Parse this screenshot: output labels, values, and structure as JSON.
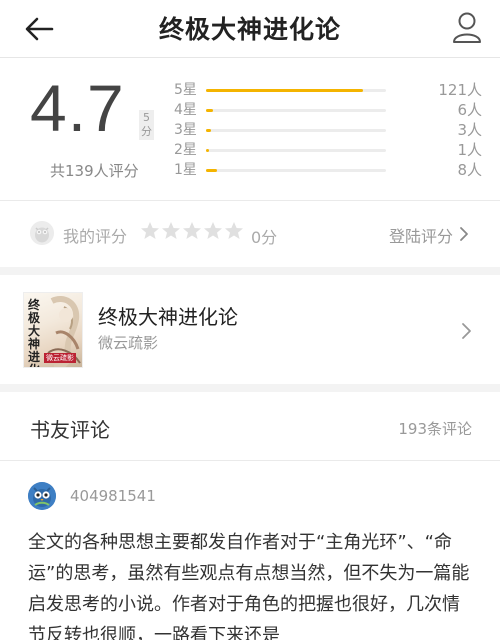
{
  "header": {
    "title": "终极大神进化论",
    "back_icon": "arrow-left-icon",
    "user_icon": "user-profile-icon"
  },
  "rating": {
    "score": "4.7",
    "scale_label": "5分",
    "total_label": "共139人评分",
    "bars": [
      {
        "label": "5星",
        "count": "121人",
        "fraction": 0.87
      },
      {
        "label": "4星",
        "count": "6人",
        "fraction": 0.04
      },
      {
        "label": "3星",
        "count": "3人",
        "fraction": 0.03
      },
      {
        "label": "2星",
        "count": "1人",
        "fraction": 0.01
      },
      {
        "label": "1星",
        "count": "8人",
        "fraction": 0.06
      }
    ],
    "accent_color": "#f4b400"
  },
  "my_rating": {
    "label": "我的评分",
    "stars": 0,
    "value": "0分",
    "login_label": "登陆评分"
  },
  "book": {
    "title": "终极大神进化论",
    "author": "微云疏影",
    "cover_title": "终极大神进化论",
    "cover_author": "微云疏影"
  },
  "reviews": {
    "title": "书友评论",
    "count": "193条评论",
    "items": [
      {
        "user": "404981541",
        "text": "全文的各种思想主要都发自作者对于“主角光环”、“命运”的思考，虽然有些观点有点想当然，但不失为一篇能启发思考的小说。作者对于角色的把握也很好，几次情节反转也很顺，一路看下来还是"
      }
    ]
  }
}
